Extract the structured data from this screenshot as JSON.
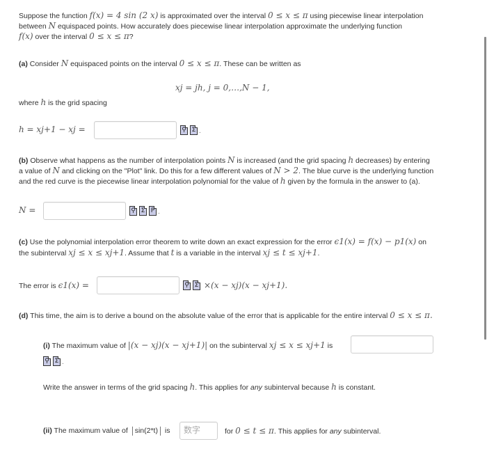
{
  "intro": {
    "line1_a": "Suppose the function ",
    "line1_math": "f(x) = 4 sin (2 x)",
    "line1_b": " is approximated over the interval ",
    "line1_interval": "0 ≤ x ≤ π",
    "line1_c": " using piecewise linear interpolation",
    "line2_a": "between ",
    "line2_N": "N",
    "line2_b": " equispaced points. How accurately does piecewise linear interpolation approximate the underlying function",
    "line3_fx": "f(x)",
    "line3_a": " over the interval ",
    "line3_interval": "0 ≤ x ≤ π",
    "line3_b": "?"
  },
  "part_a": {
    "label": "(a)",
    "text_a": " Consider ",
    "N": "N",
    "text_b": " equispaced points on the interval ",
    "interval": "0 ≤ x ≤ π",
    "text_c": ". These can be written as",
    "formula": "xj = jh,   j = 0,…,N − 1,",
    "where_a": "where ",
    "where_h": "h",
    "where_b": " is the grid spacing",
    "answer_lhs": "h = xj+1 − xj =",
    "answer_value": "",
    "icons": [
      "preview-icon",
      "sigma-icon"
    ]
  },
  "part_b": {
    "label": "(b)",
    "line1_a": " Observe what happens as the number of interpolation points ",
    "line1_N": "N",
    "line1_b": " is increased (and the grid spacing ",
    "line1_h": "h",
    "line1_c": " decreases) by entering",
    "line2_a": "a value of ",
    "line2_N": "N",
    "line2_b": " and clicking on the \"Plot\" link. Do this for a few different values of ",
    "line2_cond": "N > 2",
    "line2_c": ". The blue curve is the underlying function",
    "line3_a": "and the red curve is the piecewise linear interpolation polynomial for the value of ",
    "line3_h": "h",
    "line3_b": " given by the formula in the answer to (a).",
    "answer_lhs": "N =",
    "answer_value": "",
    "icons": [
      "preview-icon",
      "sigma-icon",
      "plot-icon"
    ]
  },
  "part_c": {
    "label": "(c)",
    "line1_a": " Use the polynomial interpolation error theorem to write down an exact expression for the error ",
    "line1_math": "ϵ1(x) = f(x) − p1(x)",
    "line1_b": " on",
    "line2_a": "the subinterval ",
    "line2_sub": "xj ≤ x ≤ xj+1",
    "line2_b": ". Assume that ",
    "line2_t": "t",
    "line2_c": " is a variable in the interval ",
    "line2_int": "xj ≤ t ≤ xj+1",
    "line2_d": ".",
    "answer_prefix": "The error is ",
    "answer_lhs": "ϵ1(x) =",
    "answer_value": "",
    "answer_suffix": "×(x − xj)(x − xj+1).",
    "icons": [
      "preview-icon",
      "sigma-icon"
    ]
  },
  "part_d": {
    "label": "(d)",
    "text": " This time, the aim is to derive a bound on the absolute value of the error that is applicable for the entire interval ",
    "interval": "0 ≤ x ≤ π.",
    "i_label": "(i)",
    "i_text_a": " The maximum value of ",
    "i_math": "|(x − xj)(x − xj+1)|",
    "i_text_b": " on the subinterval ",
    "i_sub": "xj ≤ x ≤ xj+1",
    "i_text_c": " is",
    "i_answer_value": "",
    "i_icons": [
      "preview-icon",
      "sigma-icon"
    ],
    "note_a": "Write the answer in terms of the grid spacing ",
    "note_h": "h",
    "note_b": ". This applies for ",
    "note_any": "any",
    "note_c": " subinterval because ",
    "note_h2": "h",
    "note_d": " is constant.",
    "ii_label": "(ii)",
    "ii_text_a": " The maximum value of ",
    "ii_expr": "sin(2*t)",
    "ii_text_b": " is ",
    "ii_placeholder": "数字",
    "ii_text_c": " for ",
    "ii_interval": "0 ≤ t ≤ π",
    "ii_text_d": ". This applies for ",
    "ii_any": "any",
    "ii_text_e": " subinterval."
  }
}
